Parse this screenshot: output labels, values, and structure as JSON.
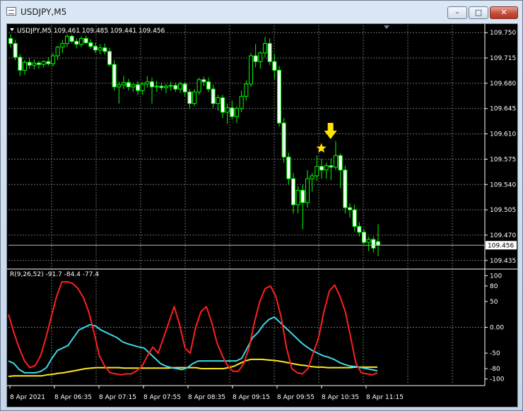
{
  "window": {
    "title": "USDJPY,M5",
    "minimize_glyph": "–",
    "maximize_glyph": "□",
    "close_glyph": "✕"
  },
  "chart_header": {
    "text": "USDJPY,M5  109.461 109.485 109.441 109.456"
  },
  "price_axis": {
    "ticks": [
      "109.750",
      "109.715",
      "109.680",
      "109.645",
      "109.610",
      "109.575",
      "109.540",
      "109.505",
      "109.470",
      "109.435"
    ],
    "current_price": "109.456"
  },
  "indicator": {
    "label": "R(9,26,52) -91.7 -84.4 -77.4",
    "ticks": [
      "100",
      "80",
      "50",
      "0.00",
      "-50",
      "-80",
      "-100"
    ]
  },
  "time_axis": {
    "labels": [
      "8 Apr 2021",
      "8 Apr 06:35",
      "8 Apr 07:15",
      "8 Apr 07:55",
      "8 Apr 08:35",
      "8 Apr 09:15",
      "8 Apr 09:55",
      "8 Apr 10:35",
      "8 Apr 11:15"
    ]
  },
  "colors": {
    "background": "#000000",
    "grid": "#6e6e6e",
    "bull_candle": "#00ff00",
    "bear_candle": "#ffffff",
    "axis_text": "#ffffff",
    "red_line": "#ff2020",
    "cyan_line": "#40d8e8",
    "yellow_line": "#ffe820",
    "signal": "#ffe400"
  },
  "signals": {
    "arrow_icon": "down-arrow-icon",
    "star_icon": "star-icon"
  },
  "chart_data": [
    {
      "type": "candlestick",
      "ylim": [
        109.425,
        109.76
      ],
      "candles": [
        [
          109.742,
          109.748,
          109.73,
          109.735
        ],
        [
          109.735,
          109.74,
          109.712,
          109.716
        ],
        [
          109.716,
          109.72,
          109.69,
          109.698
        ],
        [
          109.698,
          109.712,
          109.692,
          109.709
        ],
        [
          109.709,
          109.715,
          109.7,
          109.705
        ],
        [
          109.705,
          109.713,
          109.699,
          109.708
        ],
        [
          109.708,
          109.711,
          109.7,
          109.706
        ],
        [
          109.706,
          109.712,
          109.702,
          109.71
        ],
        [
          109.71,
          109.716,
          109.704,
          109.707
        ],
        [
          109.707,
          109.722,
          109.703,
          109.718
        ],
        [
          109.718,
          109.732,
          109.712,
          109.73
        ],
        [
          109.73,
          109.74,
          109.722,
          109.735
        ],
        [
          109.735,
          109.748,
          109.73,
          109.745
        ],
        [
          109.745,
          109.747,
          109.735,
          109.738
        ],
        [
          109.738,
          109.742,
          109.728,
          109.734
        ],
        [
          109.734,
          109.745,
          109.73,
          109.742
        ],
        [
          109.742,
          109.746,
          109.734,
          109.736
        ],
        [
          109.736,
          109.741,
          109.728,
          109.731
        ],
        [
          109.731,
          109.736,
          109.722,
          109.726
        ],
        [
          109.726,
          109.734,
          109.72,
          109.729
        ],
        [
          109.729,
          109.735,
          109.72,
          109.724
        ],
        [
          109.724,
          109.729,
          109.703,
          109.706
        ],
        [
          109.706,
          109.712,
          109.67,
          109.675
        ],
        [
          109.675,
          109.682,
          109.652,
          109.678
        ],
        [
          109.678,
          109.69,
          109.672,
          109.681
        ],
        [
          109.681,
          109.686,
          109.67,
          109.675
        ],
        [
          109.675,
          109.68,
          109.668,
          109.678
        ],
        [
          109.678,
          109.683,
          109.664,
          109.67
        ],
        [
          109.67,
          109.682,
          109.664,
          109.679
        ],
        [
          109.679,
          109.69,
          109.674,
          109.682
        ],
        [
          109.682,
          109.688,
          109.652,
          109.675
        ],
        [
          109.675,
          109.683,
          109.668,
          109.676
        ],
        [
          109.676,
          109.681,
          109.67,
          109.674
        ],
        [
          109.674,
          109.679,
          109.666,
          109.676
        ],
        [
          109.676,
          109.682,
          109.67,
          109.677
        ],
        [
          109.677,
          109.681,
          109.668,
          109.672
        ],
        [
          109.672,
          109.682,
          109.667,
          109.679
        ],
        [
          109.679,
          109.682,
          109.662,
          109.668
        ],
        [
          109.668,
          109.672,
          109.645,
          109.652
        ],
        [
          109.652,
          109.672,
          109.648,
          109.668
        ],
        [
          109.668,
          109.688,
          109.664,
          109.685
        ],
        [
          109.685,
          109.689,
          109.676,
          109.682
        ],
        [
          109.682,
          109.688,
          109.668,
          109.672
        ],
        [
          109.672,
          109.678,
          109.646,
          109.652
        ],
        [
          109.652,
          109.664,
          109.642,
          109.66
        ],
        [
          109.66,
          109.664,
          109.632,
          109.64
        ],
        [
          109.64,
          109.652,
          109.624,
          109.646
        ],
        [
          109.646,
          109.656,
          109.63,
          109.634
        ],
        [
          109.634,
          109.648,
          109.625,
          109.645
        ],
        [
          109.645,
          109.67,
          109.64,
          109.662
        ],
        [
          109.662,
          109.684,
          109.656,
          109.679
        ],
        [
          109.679,
          109.722,
          109.675,
          109.718
        ],
        [
          109.718,
          109.734,
          109.702,
          109.71
        ],
        [
          109.71,
          109.724,
          109.7,
          109.722
        ],
        [
          109.722,
          109.744,
          109.716,
          109.735
        ],
        [
          109.735,
          109.742,
          109.705,
          109.71
        ],
        [
          109.71,
          109.72,
          109.686,
          109.698
        ],
        [
          109.698,
          109.704,
          109.62,
          109.625
        ],
        [
          109.625,
          109.632,
          109.57,
          109.578
        ],
        [
          109.578,
          109.584,
          109.54,
          109.548
        ],
        [
          109.548,
          109.556,
          109.5,
          109.512
        ],
        [
          109.512,
          109.538,
          109.5,
          109.532
        ],
        [
          109.532,
          109.54,
          109.478,
          109.515
        ],
        [
          109.515,
          109.56,
          109.508,
          109.548
        ],
        [
          109.548,
          109.556,
          109.53,
          109.552
        ],
        [
          109.552,
          109.58,
          109.545,
          109.565
        ],
        [
          109.565,
          109.575,
          109.548,
          109.56
        ],
        [
          109.56,
          109.57,
          109.548,
          109.566
        ],
        [
          109.566,
          109.576,
          109.546,
          109.564
        ],
        [
          109.564,
          109.6,
          109.56,
          109.58
        ],
        [
          109.58,
          109.583,
          109.535,
          109.56
        ],
        [
          109.56,
          109.566,
          109.5,
          109.508
        ],
        [
          109.508,
          109.514,
          109.494,
          109.505
        ],
        [
          109.505,
          109.512,
          109.475,
          109.482
        ],
        [
          109.482,
          109.488,
          109.468,
          109.474
        ],
        [
          109.474,
          109.478,
          109.458,
          109.46
        ],
        [
          109.46,
          109.468,
          109.448,
          109.464
        ],
        [
          109.464,
          109.468,
          109.446,
          109.452
        ],
        [
          109.461,
          109.485,
          109.441,
          109.456
        ]
      ]
    },
    {
      "type": "line",
      "ylim": [
        -110,
        110
      ],
      "series": [
        {
          "color": "#ff2020",
          "values": [
            25,
            -10,
            -40,
            -65,
            -78,
            -74,
            -55,
            -20,
            20,
            60,
            88,
            88,
            85,
            75,
            58,
            30,
            -10,
            -55,
            -75,
            -88,
            -90,
            -92,
            -90,
            -90,
            -84,
            -75,
            -55,
            -38,
            -50,
            -20,
            10,
            40,
            5,
            -40,
            -50,
            0,
            30,
            40,
            10,
            -30,
            -55,
            -75,
            -85,
            -85,
            -70,
            -40,
            10,
            50,
            75,
            80,
            60,
            20,
            -40,
            -80,
            -88,
            -90,
            -80,
            -50,
            -20,
            30,
            70,
            82,
            60,
            30,
            -20,
            -70,
            -88,
            -90,
            -92,
            -88
          ]
        },
        {
          "color": "#40d8e8",
          "values": [
            -65,
            -70,
            -82,
            -88,
            -88,
            -88,
            -85,
            -78,
            -60,
            -45,
            -40,
            -35,
            -20,
            -5,
            0,
            5,
            3,
            -5,
            -10,
            -15,
            -20,
            -28,
            -32,
            -35,
            -38,
            -40,
            -50,
            -60,
            -70,
            -75,
            -78,
            -80,
            -82,
            -78,
            -70,
            -65,
            -65,
            -65,
            -65,
            -65,
            -65,
            -65,
            -65,
            -60,
            -40,
            -20,
            -10,
            5,
            15,
            20,
            10,
            0,
            -10,
            -20,
            -30,
            -38,
            -45,
            -50,
            -55,
            -58,
            -62,
            -68,
            -72,
            -75,
            -76,
            -78,
            -80,
            -82,
            -84
          ]
        },
        {
          "color": "#ffe820",
          "values": [
            -95,
            -94,
            -94,
            -94,
            -94,
            -94,
            -94,
            -92,
            -91,
            -89,
            -88,
            -86,
            -84,
            -82,
            -80,
            -79,
            -78,
            -78,
            -78,
            -78,
            -78,
            -79,
            -79,
            -79,
            -79,
            -79,
            -79,
            -79,
            -79,
            -79,
            -78,
            -78,
            -78,
            -78,
            -78,
            -80,
            -80,
            -80,
            -80,
            -80,
            -78,
            -75,
            -70,
            -65,
            -62,
            -62,
            -62,
            -63,
            -64,
            -65,
            -67,
            -69,
            -71,
            -73,
            -74,
            -76,
            -77,
            -77,
            -78,
            -78,
            -78,
            -78,
            -78,
            -77,
            -77,
            -77,
            -77,
            -77
          ]
        }
      ]
    }
  ]
}
